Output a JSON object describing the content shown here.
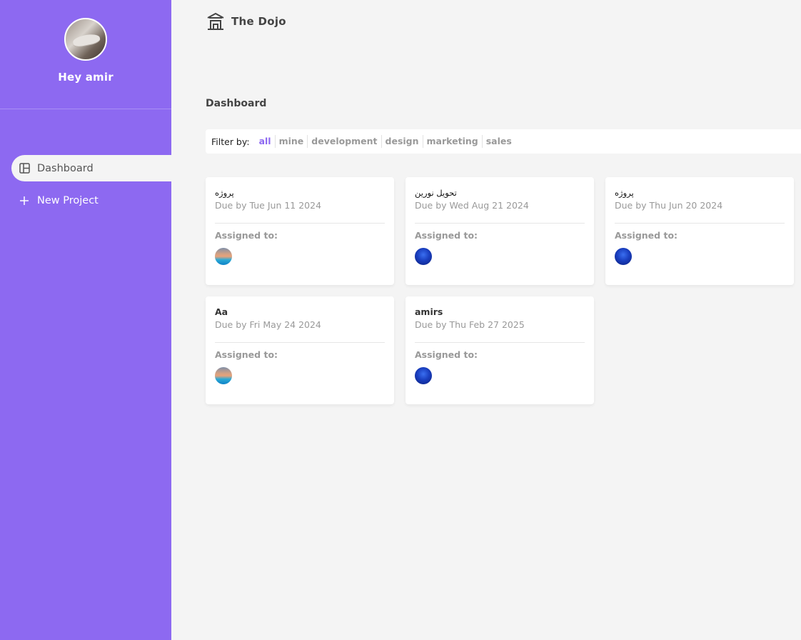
{
  "app": {
    "brand_name": "The Dojo"
  },
  "sidebar": {
    "greeting": "Hey amir",
    "items": [
      {
        "label": "Dashboard",
        "icon": "dashboard-icon",
        "active": true
      },
      {
        "label": "New Project",
        "icon": "plus-icon",
        "active": false
      }
    ]
  },
  "main": {
    "title": "Dashboard",
    "filter": {
      "label": "Filter by:",
      "options": [
        "all",
        "mine",
        "development",
        "design",
        "marketing",
        "sales"
      ],
      "selected": "all"
    },
    "projects": [
      {
        "name": "پروژه",
        "due": "Due by Tue Jun 11 2024",
        "assigned_label": "Assigned to:",
        "avatar": "beach"
      },
      {
        "name": "تحویل نورین",
        "due": "Due by Wed Aug 21 2024",
        "assigned_label": "Assigned to:",
        "avatar": "sea"
      },
      {
        "name": "پروژه",
        "due": "Due by Thu Jun 20 2024",
        "assigned_label": "Assigned to:",
        "avatar": "sea"
      },
      {
        "name": "Aa",
        "due": "Due by Fri May 24 2024",
        "assigned_label": "Assigned to:",
        "avatar": "beach"
      },
      {
        "name": "amirs",
        "due": "Due by Thu Feb 27 2025",
        "assigned_label": "Assigned to:",
        "avatar": "sea"
      }
    ]
  },
  "colors": {
    "accent": "#8d69f1",
    "background": "#f4f4f4",
    "muted_text": "#999999"
  }
}
